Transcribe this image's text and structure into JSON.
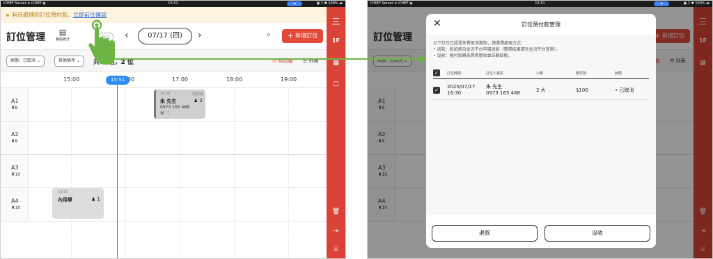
{
  "status_bar": {
    "left": "iCHEF Server  ≋ iCHEF  ◉",
    "time": "15:51",
    "right": "▣ 1 ✱ 100% ▬",
    "cloud": "☁"
  },
  "notice": {
    "text": "有待處理的訂位預付款，",
    "link": "立即前往確認"
  },
  "header": {
    "title": "訂位管理",
    "stats_label": "餐點統計",
    "today": "今日",
    "date": "07/17 (四)",
    "add_button": "新增訂位"
  },
  "filters": {
    "status": "狀態：已取消 ⌄",
    "other": "其他條件 ⌄",
    "count": "共 1 組，2 位",
    "timeline_view": "◷ 時間軸",
    "list_view": "☰ 列表"
  },
  "timeline": {
    "times": [
      "15:00",
      "16:00",
      "17:00",
      "18:00",
      "19:00"
    ],
    "now": "15:51"
  },
  "tables": [
    {
      "name": "A1",
      "capacity": "8"
    },
    {
      "name": "A2",
      "capacity": "8"
    },
    {
      "name": "A3",
      "capacity": "10"
    },
    {
      "name": "A4",
      "capacity": "10"
    }
  ],
  "bookings": {
    "b1": {
      "time": "16:30",
      "status": "已取消",
      "name": "朱 先生",
      "people": "2",
      "phone": "0973 165 488",
      "icons": "⑤ 🍴"
    },
    "b2": {
      "time": "14:37",
      "name": "內用單",
      "people": "1"
    }
  },
  "rail": {
    "brand": "三",
    "floor": "1F"
  },
  "dialog": {
    "title": "訂位預付款管理",
    "note_lines": [
      "以下訂位已超過免費取消期限，請選擇處理方式：",
      "• 退款：系統將向金流平台申請退款（實際結果請至金流平台查詢）。",
      "• 沒收：預付款轉為實際營收並自動結帳。"
    ],
    "columns": [
      "訂位時間",
      "訂位人資訊",
      "人數",
      "預付款",
      "狀態"
    ],
    "row": {
      "date": "2025/07/17",
      "time": "16:30",
      "name": "朱 先生",
      "phone": "0973 165 488",
      "people": "2 大",
      "deposit": "$100",
      "status": "• 已取消"
    },
    "refund_button": "退款",
    "confiscate_button": "沒收"
  },
  "colors": {
    "brand_red": "#d94436",
    "accent_blue": "#2d8cf0",
    "arrow_green": "#6cb544"
  }
}
